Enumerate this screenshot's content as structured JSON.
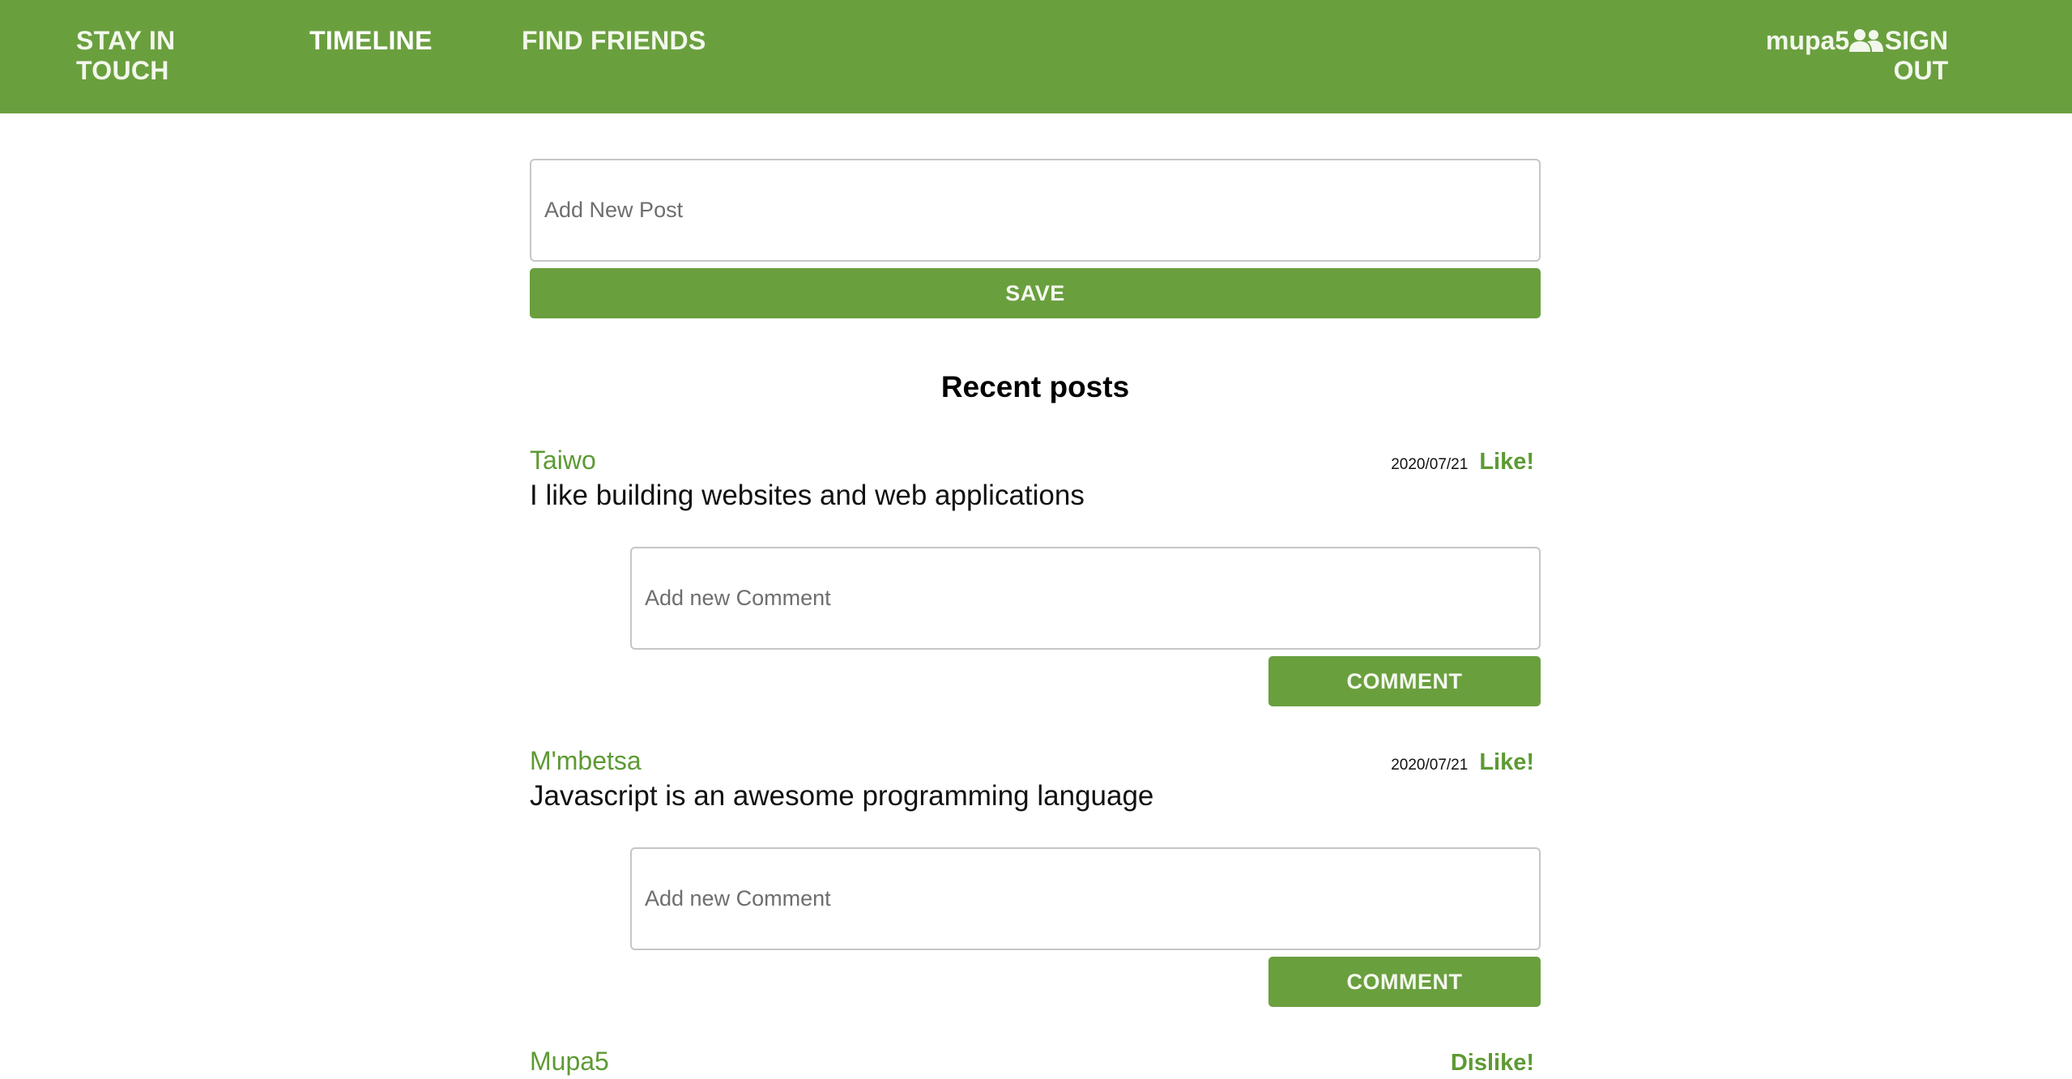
{
  "nav": {
    "brand": "STAY IN TOUCH",
    "timeline": "TIMELINE",
    "find_friends": "FIND FRIENDS",
    "username": "mupa5",
    "user_icon": "users-icon",
    "sign_out": "SIGN OUT"
  },
  "composer": {
    "placeholder": "Add New Post",
    "save_label": "SAVE"
  },
  "feed": {
    "title": "Recent posts",
    "posts": [
      {
        "author": "Taiwo",
        "date": "2020/07/21",
        "like_label": "Like!",
        "text": "I like building websites and web applications",
        "comment_placeholder": "Add new Comment",
        "comment_label": "COMMENT"
      },
      {
        "author": "M'mbetsa",
        "date": "2020/07/21",
        "like_label": "Like!",
        "text": "Javascript is an awesome programming language",
        "comment_placeholder": "Add new Comment",
        "comment_label": "COMMENT"
      },
      {
        "author": "Mupa5",
        "like_label": "Dislike!"
      }
    ]
  },
  "colors": {
    "brand_green": "#6a9f3e",
    "link_green": "#5d9a33"
  }
}
